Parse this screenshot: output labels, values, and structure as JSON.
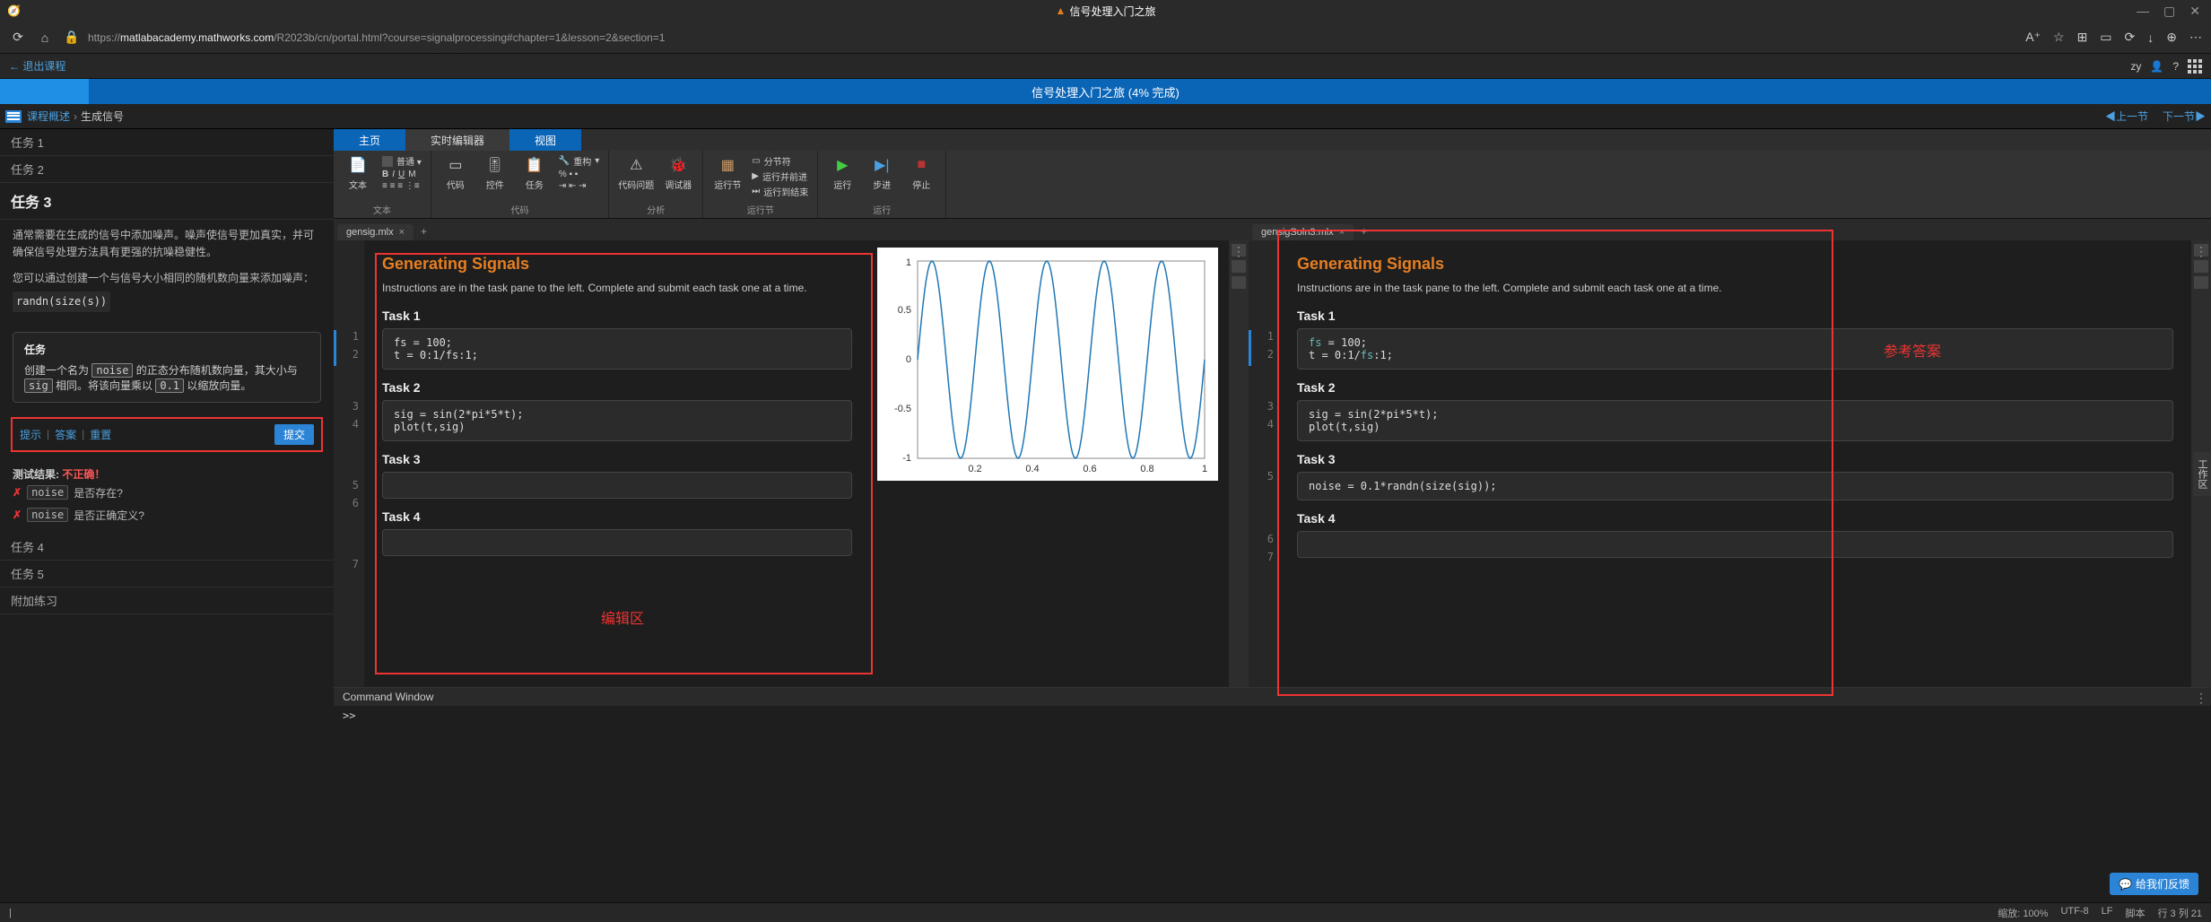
{
  "window": {
    "title": "信号处理入门之旅",
    "min": "—",
    "max": "▢",
    "close": "✕"
  },
  "browser": {
    "url_prefix": "https://",
    "url_host": "matlabacademy.mathworks.com",
    "url_path": "/R2023b/cn/portal.html?course=signalprocessing#chapter=1&lesson=2&section=1"
  },
  "course": {
    "exit": "← 退出课程",
    "user": "zy"
  },
  "progress": {
    "title": "信号处理入门之旅",
    "pct": "(4% 完成)"
  },
  "crumb": {
    "root": "课程概述",
    "current": "生成信号",
    "prev": "◀上一节",
    "next": "下一节▶"
  },
  "sidebar": {
    "tasks": [
      "任务 1",
      "任务 2",
      "任务 3",
      "任务 4",
      "任务 5"
    ],
    "extra": "附加练习",
    "desc1": "通常需要在生成的信号中添加噪声。噪声使信号更加真实，并可确保信号处理方法具有更强的抗噪稳健性。",
    "desc2": "您可以通过创建一个与信号大小相同的随机数向量来添加噪声：",
    "code_ex": "randn(size(s))",
    "box_title": "任务",
    "box_text1": "创建一个名为 ",
    "box_k1": "noise",
    "box_text2": " 的正态分布随机数向量，其大小与 ",
    "box_k2": "sig",
    "box_text3": " 相同。将该向量乘以 ",
    "box_k3": "0.1",
    "box_text4": " 以缩放向量。",
    "hint": "提示",
    "answer": "答案",
    "reset": "重置",
    "submit": "提交",
    "result_label": "测试结果: ",
    "result_val": "不正确！",
    "check1": "noise 是否存在?",
    "check2": "noise 是否正确定义?"
  },
  "toolstrip": {
    "tabs": [
      "主页",
      "实时编辑器",
      "视图"
    ],
    "section_text": "文本",
    "section_code": "代码",
    "section_analyze": "分析",
    "section_section": "运行节",
    "section_run": "运行",
    "btns": {
      "text": "文本",
      "code": "代码",
      "control": "控件",
      "task": "任务",
      "refactor": "重构",
      "comment": "注释",
      "codeissue": "代码问题",
      "debugger": "调试器",
      "runsection": "运行节",
      "sectionbreak": "分节符",
      "runandadvance": "运行并前进",
      "runtoend": "运行到结束",
      "run": "运行",
      "step": "步进",
      "stop": "停止"
    }
  },
  "editor": {
    "left_file": "gensig.mlx",
    "right_file": "gensigSoln3.mlx",
    "doc_title": "Generating Signals",
    "doc_text": "Instructions are in the task pane to the left. Complete and submit each task one at a time.",
    "tasks": [
      "Task 1",
      "Task 2",
      "Task 3",
      "Task 4"
    ],
    "code1": "fs = 100;\nt = 0:1/fs:1;",
    "code2": "sig = sin(2*pi*5*t);\nplot(t,sig)",
    "code3_right": "noise = 0.1*randn(size(sig));",
    "left_lines": [
      "1",
      "2",
      "3",
      "4",
      "5",
      "6",
      "7"
    ],
    "right_lines": [
      "1",
      "2",
      "3",
      "4",
      "5",
      "6",
      "7"
    ],
    "edit_label": "编辑区",
    "ref_label": "参考答案"
  },
  "chart_data": {
    "type": "line",
    "title": "",
    "xlabel": "",
    "ylabel": "",
    "xlim": [
      0,
      1
    ],
    "ylim": [
      -1,
      1
    ],
    "xticks": [
      0.2,
      0.4,
      0.6,
      0.8,
      1
    ],
    "yticks": [
      -1,
      -0.5,
      0,
      0.5,
      1
    ],
    "description": "sin(2*pi*5*t) for t in [0,1], 5 full cycles",
    "series": [
      {
        "name": "sig",
        "formula": "sin(2*pi*5*t)",
        "frequency_hz": 5,
        "amplitude": 1
      }
    ]
  },
  "cmdwin": {
    "title": "Command Window",
    "prompt": ">>"
  },
  "feedback": "给我们反馈",
  "status": {
    "zoom": "缩放: 100%",
    "enc": "UTF-8",
    "lf": "LF",
    "mode": "脚本",
    "pos": "行 3 列 21"
  },
  "vtab": "工作区"
}
